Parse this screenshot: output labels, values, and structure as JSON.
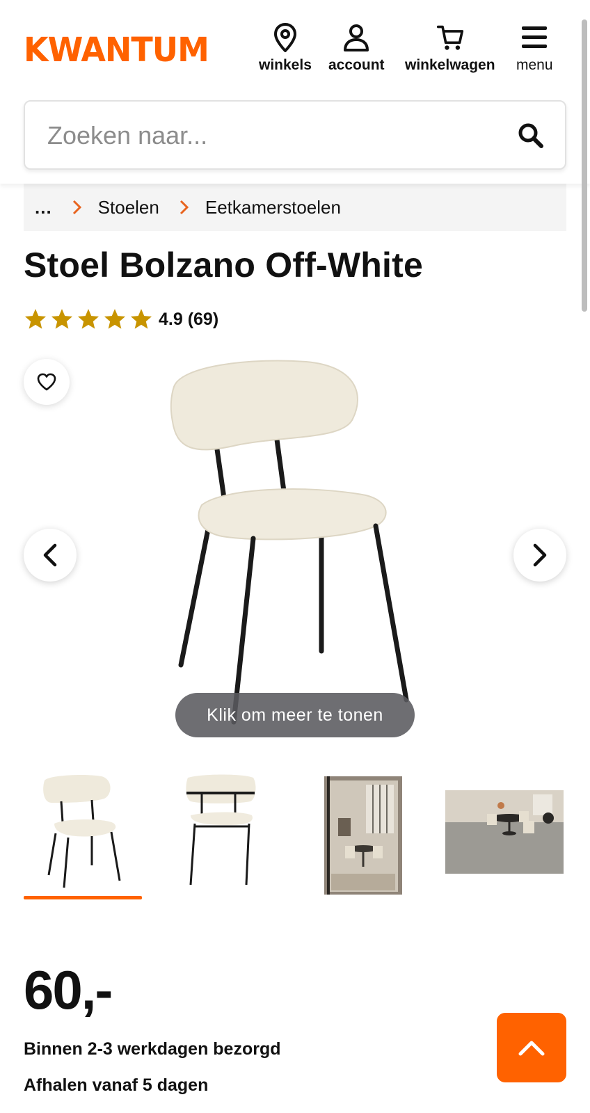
{
  "brand": {
    "logo_text": "KWANTUM",
    "accent": "#ff6200"
  },
  "nav": {
    "stores_label": "winkels",
    "account_label": "account",
    "cart_label": "winkelwagen",
    "menu_label": "menu"
  },
  "search": {
    "placeholder": "Zoeken naar...",
    "value": ""
  },
  "breadcrumb": {
    "ellipsis": "...",
    "items": [
      "Stoelen",
      "Eetkamerstoelen"
    ]
  },
  "product": {
    "title": "Stoel Bolzano Off-White",
    "rating_value": 4.9,
    "rating_text": "4.9 (69)",
    "stars_filled": 5,
    "star_color": "#c89400",
    "show_more_label": "Klik om meer te tonen",
    "thumbnail_count": 4,
    "active_thumbnail": 1,
    "price": "60,-",
    "delivery_line": "Binnen 2-3 werkdagen bezorgd",
    "pickup_line": "Afhalen vanaf 5 dagen"
  },
  "icons": {
    "stores": "map-pin-icon",
    "account": "user-icon",
    "cart": "shopping-cart-icon",
    "menu": "hamburger-menu-icon",
    "search": "search-icon",
    "favorite": "heart-icon",
    "prev": "chevron-left-icon",
    "next": "chevron-right-icon",
    "to_top": "chevron-up-icon"
  }
}
